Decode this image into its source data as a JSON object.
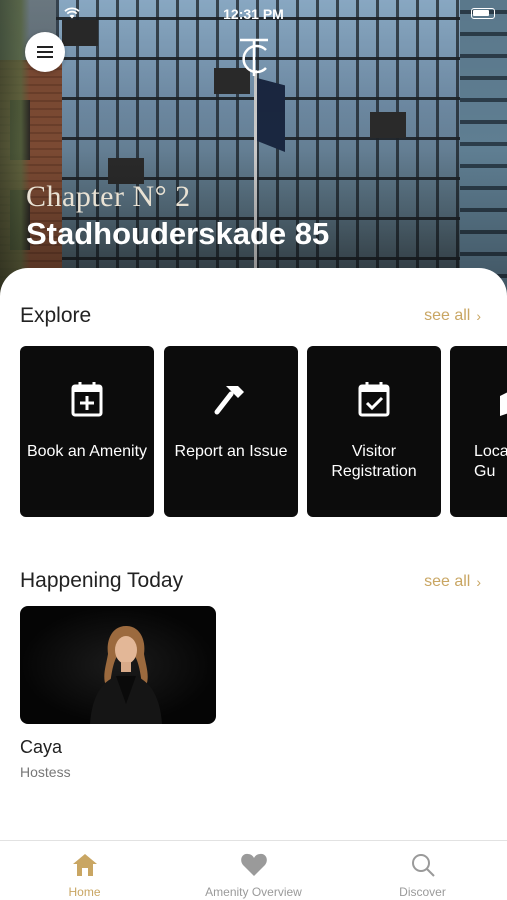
{
  "status_bar": {
    "time": "12:31 PM"
  },
  "hero": {
    "chapter": "Chapter N° 2",
    "address": "Stadhouderskade 85"
  },
  "explore": {
    "title": "Explore",
    "see_all": "see all",
    "cards": [
      {
        "label": "Book an Amenity",
        "icon": "calendar-plus-icon"
      },
      {
        "label": "Report an Issue",
        "icon": "hammer-icon"
      },
      {
        "label": "Visitor Registration",
        "icon": "calendar-check-icon"
      },
      {
        "label": "Loca\nGu",
        "icon": "map-icon"
      }
    ]
  },
  "happening_today": {
    "title": "Happening Today",
    "see_all": "see all",
    "event": {
      "name": "Caya",
      "role": "Hostess"
    }
  },
  "tabs": [
    {
      "label": "Home",
      "icon": "home-icon",
      "active": true
    },
    {
      "label": "Amenity Overview",
      "icon": "heart-icon",
      "active": false
    },
    {
      "label": "Discover",
      "icon": "search-icon",
      "active": false
    }
  ],
  "colors": {
    "accent": "#c9a663",
    "card": "#0c0c0c",
    "inactive": "#9a9a9a"
  }
}
